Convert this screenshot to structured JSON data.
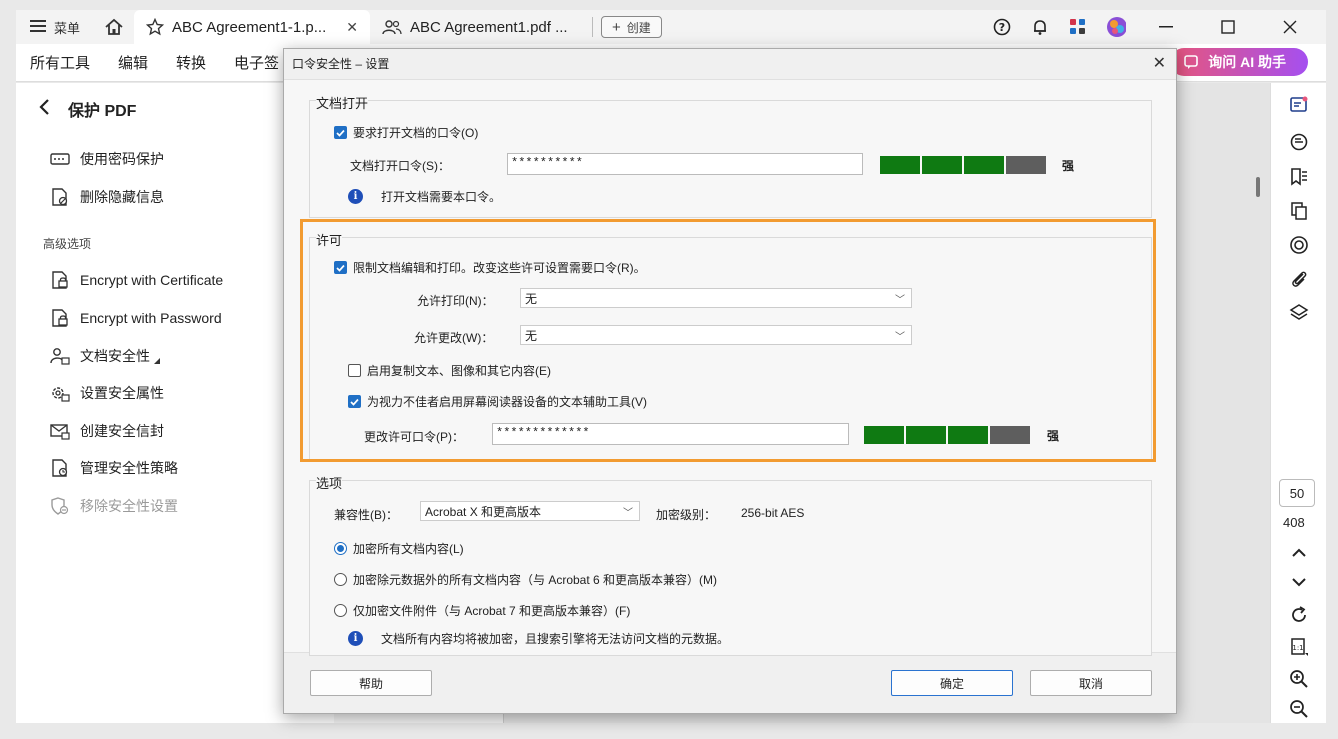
{
  "topbar": {
    "menu_label": "菜单",
    "tabs": [
      {
        "label": "ABC Agreement1-1.p..."
      },
      {
        "label": "ABC Agreement1.pdf ..."
      }
    ],
    "create_label": "创建"
  },
  "toolbar": {
    "items": [
      "所有工具",
      "编辑",
      "转换",
      "电子签"
    ],
    "ai_label": "询问 AI 助手"
  },
  "leftpanel": {
    "title": "保护 PDF",
    "items_top": [
      "使用密码保护",
      "删除隐藏信息"
    ],
    "section_label": "高级选项",
    "items_adv": [
      "Encrypt with Certificate",
      "Encrypt with Password",
      "文档安全性",
      "设置安全属性",
      "创建安全信封",
      "管理安全性策略",
      "移除安全性设置"
    ]
  },
  "rightbar": {
    "page_current": "50",
    "page_total": "408"
  },
  "dialog": {
    "title": "口令安全性 – 设置",
    "doc_open": {
      "group_label": "文档打开",
      "require_label": "要求打开文档的口令(O)",
      "require_checked": true,
      "password_label": "文档打开口令(S)：",
      "password_value": "**********",
      "strength_label": "强",
      "info_text": "打开文档需要本口令。"
    },
    "permissions": {
      "group_label": "许可",
      "restrict_label": "限制文档编辑和打印。改变这些许可设置需要口令(R)。",
      "restrict_checked": true,
      "print_label": "允许打印(N)：",
      "print_value": "无",
      "change_label": "允许更改(W)：",
      "change_value": "无",
      "copy_label": "启用复制文本、图像和其它内容(E)",
      "copy_checked": false,
      "access_label": "为视力不佳者启用屏幕阅读器设备的文本辅助工具(V)",
      "access_checked": true,
      "perm_password_label": "更改许可口令(P)：",
      "perm_password_value": "*************",
      "strength_label": "强"
    },
    "options": {
      "group_label": "选项",
      "compat_label": "兼容性(B)：",
      "compat_value": "Acrobat X 和更高版本",
      "level_label": "加密级别：",
      "level_value": "256-bit AES",
      "radio_all": "加密所有文档内容(L)",
      "radio_except_meta": "加密除元数据外的所有文档内容（与 Acrobat 6 和更高版本兼容）(M)",
      "radio_attach": "仅加密文件附件（与 Acrobat 7 和更高版本兼容）(F)",
      "info_text": "文档所有内容均将被加密，且搜索引擎将无法访问文档的元数据。"
    },
    "buttons": {
      "help": "帮助",
      "ok": "确定",
      "cancel": "取消"
    }
  },
  "colors": {
    "highlight": "#f29b31",
    "strength_green": "#0f7a12",
    "strength_gray": "#5e5e5e",
    "accent": "#1f6fc5"
  }
}
